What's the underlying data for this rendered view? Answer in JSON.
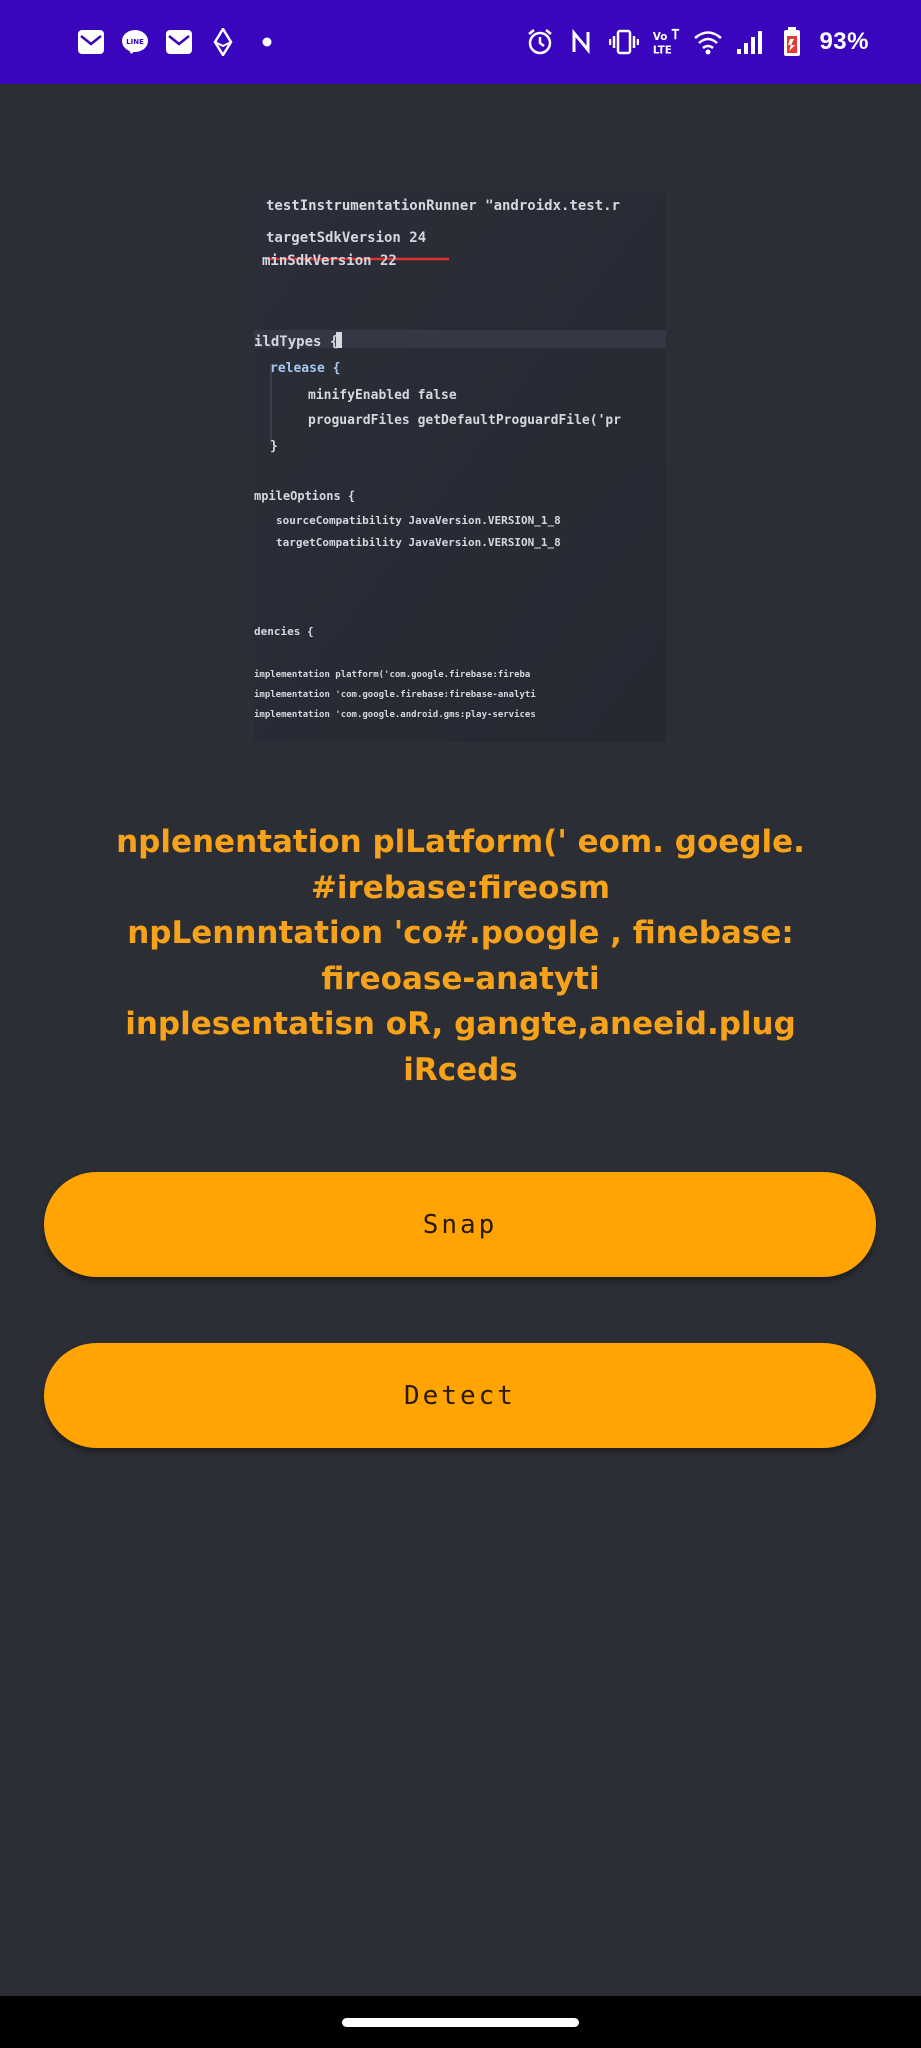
{
  "status_bar": {
    "battery_percent": "93%",
    "left_icons": [
      "mail-icon",
      "line-app-icon",
      "mail-icon",
      "ethereum-icon",
      "dot-icon"
    ],
    "right_icons": [
      "alarm-icon",
      "nfc-icon",
      "vibrate-icon",
      "volte-icon",
      "wifi-icon",
      "signal-icon",
      "battery-icon"
    ],
    "background_color": "#3a06bd"
  },
  "captured_image": {
    "lines": [
      "testInstrumentationRunner \"androidx.test.r",
      "targetSdkVersion 24",
      "minSdkVersion 22",
      "ildTypes {",
      "release {",
      "minifyEnabled false",
      "proguardFiles getDefaultProguardFile('pr",
      "}",
      "mpileOptions {",
      "sourceCompatibility JavaVersion.VERSION_1_8",
      "targetCompatibility JavaVersion.VERSION_1_8",
      "dencies {",
      "implementation platform('com.google.firebase:fireba",
      "implementation 'com.google.firebase:firebase-analyti",
      "implementation 'com.google.android.gms:play-services"
    ]
  },
  "result": {
    "text": "nplenentation plLatform(' eom. goegle.\n#irebase:fireosm\nnpLennntation 'co#.poogle , finebase:\nfireoase-anatyti\ninplesentatisn oR, gangte,aneeid.plug iRceds"
  },
  "buttons": {
    "snap_label": "Snap",
    "detect_label": "Detect"
  },
  "colors": {
    "accent": "#ffa402",
    "result_text": "#f6a21b",
    "background": "#2c2e35"
  }
}
